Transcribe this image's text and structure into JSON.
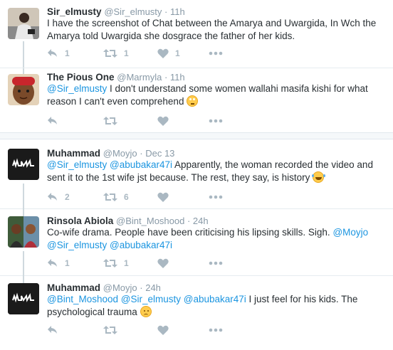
{
  "colors": {
    "link": "#1b95e0",
    "text": "#292f33",
    "muted": "#8899a6",
    "icon": "#aab8c2"
  },
  "icons": {
    "reply": "reply-icon",
    "retweet": "retweet-icon",
    "like": "heart-icon",
    "more": "more-icon"
  },
  "tweets": [
    {
      "name": "Sir_elmusty",
      "handle": "@Sir_elmusty",
      "sep": " · ",
      "time": "11h",
      "text": "I have the screenshot of Chat between the Amarya and Uwargida, In Wch the Amarya told Uwargida she dosgrace the father of her kids.",
      "retweets": "1",
      "replies": "1",
      "likes": "1"
    },
    {
      "name": "The Pious One",
      "handle": "@Marmyla",
      "sep": " · ",
      "time": "11h",
      "mention": "@Sir_elmusty",
      "text": " I don't understand some women wallahi masifa kishi for what reason I can't even comprehend "
    },
    {
      "name": "Muhammad",
      "handle": "@Moyjo",
      "sep": " · ",
      "time": "Dec 13",
      "mention1": "@Sir_elmusty",
      "mention2": "@abubakar47i",
      "text": " Apparently, the woman recorded the video and sent it to the 1st wife jst because. The rest, they say, is history ",
      "replies": "2",
      "retweets": "6"
    },
    {
      "name": "Rinsola Abiola",
      "handle": "@Bint_Moshood",
      "sep": " · ",
      "time": "24h",
      "text": "Co-wife drama. People have been criticising his lipsing skills. Sigh. ",
      "mention1": "@Moyjo",
      "mention2": "@Sir_elmusty",
      "mention3": "@abubakar47i",
      "replies": "1",
      "retweets": "1"
    },
    {
      "name": "Muhammad",
      "handle": "@Moyjo",
      "sep": " · ",
      "time": "24h",
      "mention1": "@Bint_Moshood",
      "mention2": "@Sir_elmusty",
      "mention3": "@abubakar47i",
      "text": " I just feel for his kids. The psychological trauma "
    }
  ]
}
